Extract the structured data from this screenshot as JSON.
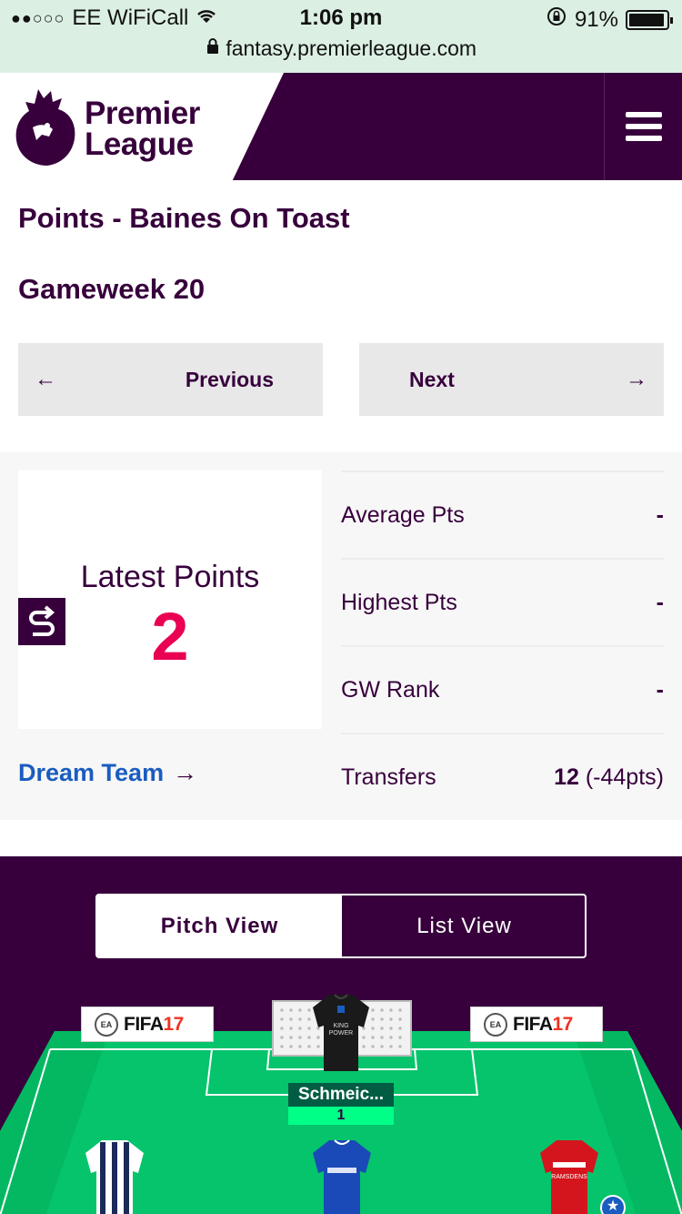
{
  "status_bar": {
    "carrier": "EE WiFiCall",
    "time": "1:06 pm",
    "battery": "91%",
    "url": "fantasy.premierleague.com"
  },
  "header": {
    "logo_line1": "Premier",
    "logo_line2": "League"
  },
  "page": {
    "title": "Points - Baines On Toast",
    "gameweek": "Gameweek 20"
  },
  "nav": {
    "previous_label": "Previous",
    "next_label": "Next"
  },
  "latest": {
    "label": "Latest Points",
    "value": "2"
  },
  "stats": [
    {
      "key": "Average Pts",
      "value": "-",
      "extra": ""
    },
    {
      "key": "Highest Pts",
      "value": "-",
      "extra": ""
    },
    {
      "key": "GW Rank",
      "value": "-",
      "extra": ""
    },
    {
      "key": "Transfers",
      "value": "12",
      "extra": " (-44pts)"
    }
  ],
  "dream_team_label": "Dream Team",
  "view_toggle": {
    "pitch_view": "Pitch View",
    "list_view": "List View",
    "active": "Pitch View"
  },
  "pitch": {
    "ad_brand": "FIFA",
    "ad_number": "17",
    "ad_ea": "EA",
    "goalkeeper": {
      "name": "Schmeic...",
      "points": "1",
      "kit_text": "KING POWER"
    },
    "midfield_kit_text": "RAMSDENS"
  },
  "colors": {
    "brand_purple": "#37003c",
    "points_pink": "#e90052",
    "pitch_green": "#05c46b",
    "link_blue": "#1a5cbf"
  }
}
